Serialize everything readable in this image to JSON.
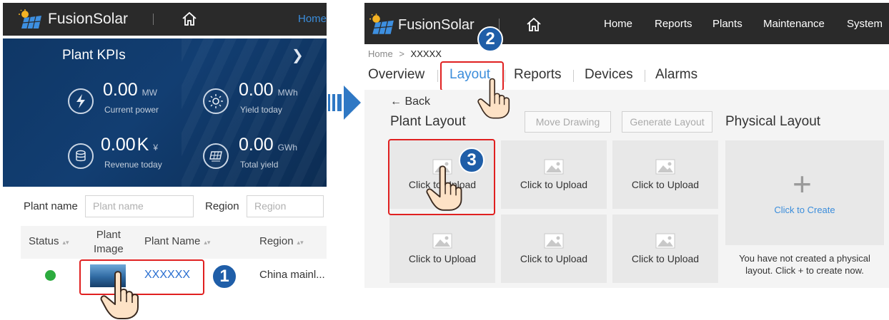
{
  "left_app": {
    "brand": "FusionSolar",
    "home_label": "Home",
    "kpi": {
      "title": "Plant KPIs",
      "items": [
        {
          "icon": "lightning-icon",
          "value": "0.00",
          "unit": "MW",
          "label": "Current power"
        },
        {
          "icon": "sun-icon",
          "value": "0.00",
          "unit": "MWh",
          "label": "Yield today"
        },
        {
          "icon": "coins-icon",
          "value": "0.00",
          "value_suffix": "K",
          "unit": "¥",
          "label": "Revenue today"
        },
        {
          "icon": "solar-panel-icon",
          "value": "0.00",
          "unit": "GWh",
          "label": "Total yield"
        }
      ]
    },
    "filters": {
      "plant_name_label": "Plant name",
      "plant_name_placeholder": "Plant name",
      "region_label": "Region",
      "region_placeholder": "Region"
    },
    "table": {
      "headers": {
        "status": "Status",
        "image_line1": "Plant",
        "image_line2": "Image",
        "name": "Plant Name",
        "region": "Region"
      },
      "rows": [
        {
          "status": "online",
          "status_color": "#2cab3e",
          "name": "XXXXXX",
          "region": "China mainl..."
        }
      ]
    }
  },
  "right_app": {
    "brand": "FusionSolar",
    "nav": [
      "Home",
      "Reports",
      "Plants",
      "Maintenance",
      "System"
    ],
    "breadcrumb": {
      "home": "Home",
      "sep": ">",
      "current": "XXXXX"
    },
    "tabs": [
      "Overview",
      "Layout",
      "Reports",
      "Devices",
      "Alarms"
    ],
    "active_tab": "Layout",
    "back_label": "Back",
    "plant_layout_title": "Plant Layout",
    "move_drawing_label": "Move Drawing",
    "generate_layout_label": "Generate Layout",
    "physical_layout_title": "Physical Layout",
    "upload_label": "Click to Upload",
    "upload_cells": [
      "Click to Upload",
      "Click to Upload",
      "Click to Upload",
      "Click to Upload",
      "Click to Upload",
      "Click to Upload"
    ],
    "create_label": "Click to Create",
    "physical_note": "You have not created a physical layout. Click + to create now."
  },
  "steps": [
    "1",
    "2",
    "3"
  ],
  "colors": {
    "accent": "#3b8ddb",
    "highlight": "#e02020",
    "badge": "#1f5ea8",
    "topbar": "#2a2a2a",
    "kpi_bg": "#123e72"
  }
}
